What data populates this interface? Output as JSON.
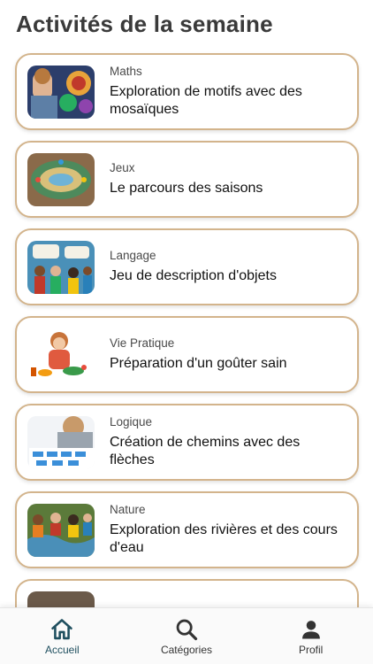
{
  "header": {
    "title": "Activités de la semaine"
  },
  "activities": [
    {
      "category": "Maths",
      "title": "Exploration de motifs avec des mosaïques",
      "thumb_icon": "mosaic-image"
    },
    {
      "category": "Jeux",
      "title": "Le parcours des saisons",
      "thumb_icon": "board-game-image"
    },
    {
      "category": "Langage",
      "title": "Jeu de description d'objets",
      "thumb_icon": "children-talking-image"
    },
    {
      "category": "Vie Pratique",
      "title": "Préparation d'un goûter sain",
      "thumb_icon": "child-cooking-image"
    },
    {
      "category": "Logique",
      "title": "Création de chemins avec des flèches",
      "thumb_icon": "arrow-cards-image"
    },
    {
      "category": "Nature",
      "title": "Exploration des rivières et des cours d'eau",
      "thumb_icon": "children-river-image"
    }
  ],
  "nav": {
    "items": [
      {
        "label": "Accueil",
        "icon": "home-icon",
        "active": true
      },
      {
        "label": "Catégories",
        "icon": "search-icon",
        "active": false
      },
      {
        "label": "Profil",
        "icon": "person-icon",
        "active": false
      }
    ]
  },
  "colors": {
    "card_border": "#d3b48c",
    "nav_active": "#1f4f5f",
    "title": "#3a3a3a"
  }
}
